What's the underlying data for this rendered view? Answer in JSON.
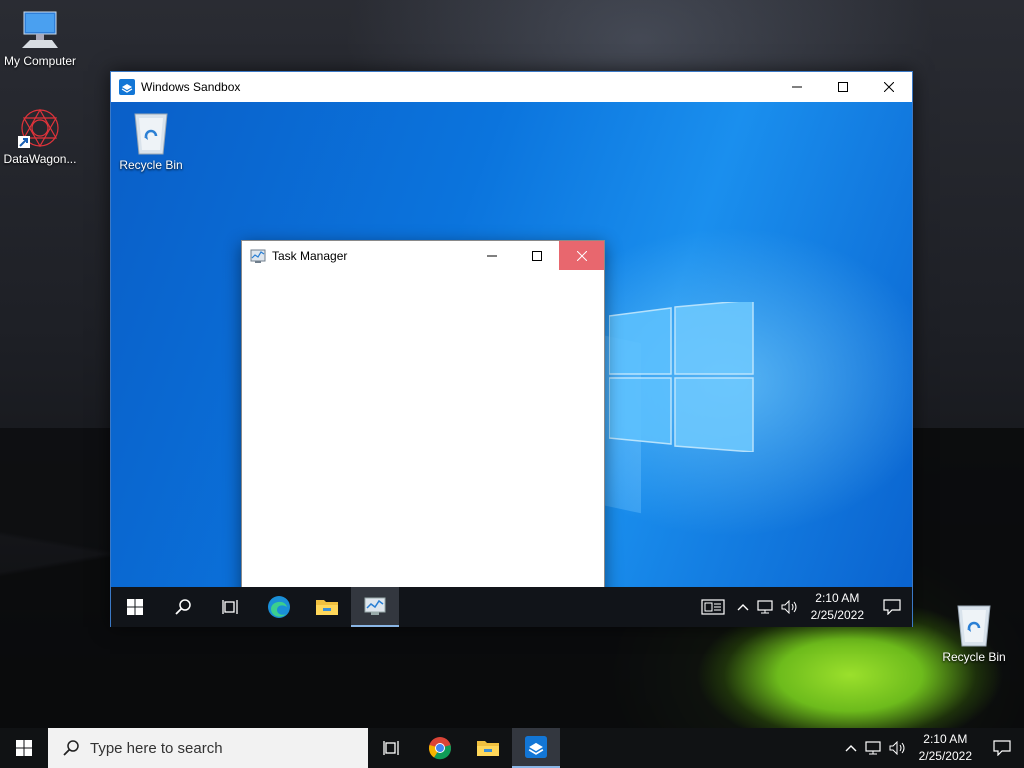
{
  "host": {
    "desktop_icons": [
      {
        "label": "My Computer",
        "icon": "computer-icon"
      },
      {
        "label": "DataWagon...",
        "icon": "datawagon-shortcut-icon"
      },
      {
        "label": "Recycle Bin",
        "icon": "recycle-bin-icon"
      }
    ],
    "taskbar": {
      "search_placeholder": "Type here to search",
      "clock_time": "2:10 AM",
      "clock_date": "2/25/2022"
    }
  },
  "sandbox": {
    "title": "Windows Sandbox",
    "desktop_icons": [
      {
        "label": "Recycle Bin",
        "icon": "recycle-bin-icon"
      }
    ],
    "taskbar": {
      "clock_time": "2:10 AM",
      "clock_date": "2/25/2022"
    },
    "task_manager": {
      "title": "Task Manager"
    }
  },
  "colors": {
    "sandbox_accent": "#0a74da",
    "close_hover": "#e8676e",
    "taskbar": "#111419"
  }
}
